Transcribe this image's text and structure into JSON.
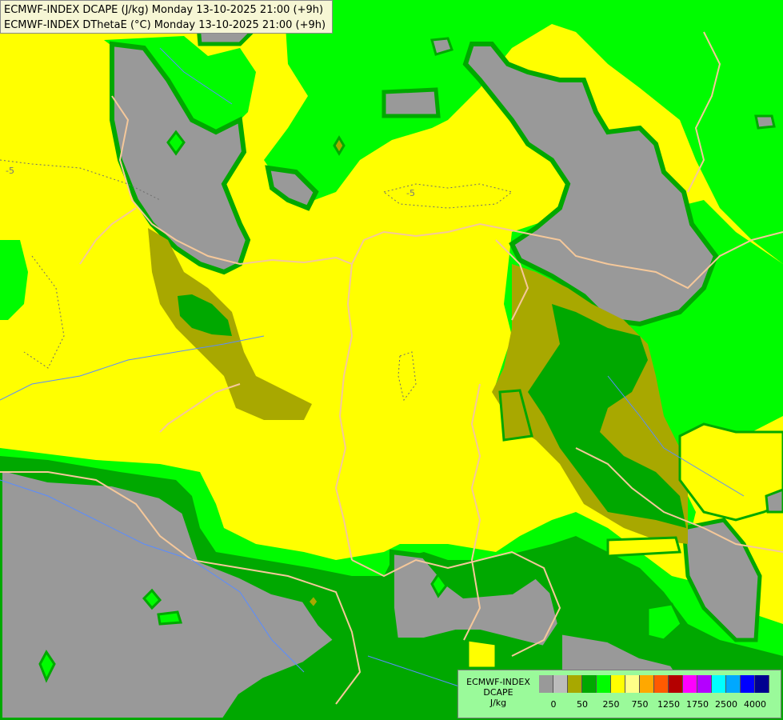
{
  "header": {
    "line1": "ECMWF-INDEX DCAPE (J/kg) Monday 13-10-2025 21:00 (+9h)",
    "line2": "ECMWF-INDEX DThetaE (°C) Monday 13-10-2025 21:00 (+9h)"
  },
  "contour_labels": [
    "-5",
    "-5"
  ],
  "colors": {
    "gray": "#999999",
    "olive": "#a8a800",
    "dark_green": "#00a800",
    "green": "#00fc00",
    "yellow": "#ffff00",
    "border": "#f5c89a",
    "river": "#5a8cff"
  },
  "legend": {
    "title_line1": "ECMWF-INDEX",
    "title_line2": "DCAPE",
    "unit": "J/kg",
    "swatch_colors": [
      "#999999",
      "#bcbcbc",
      "#a8a800",
      "#00a800",
      "#00fc00",
      "#ffff00",
      "#ffff88",
      "#ffa800",
      "#ff5a00",
      "#b40000",
      "#ff00ff",
      "#b400ff",
      "#00ffff",
      "#00a8ff",
      "#0000ff",
      "#000090"
    ],
    "tick_labels": [
      "0",
      "50",
      "250",
      "750",
      "1250",
      "1750",
      "2500",
      "4000"
    ]
  }
}
